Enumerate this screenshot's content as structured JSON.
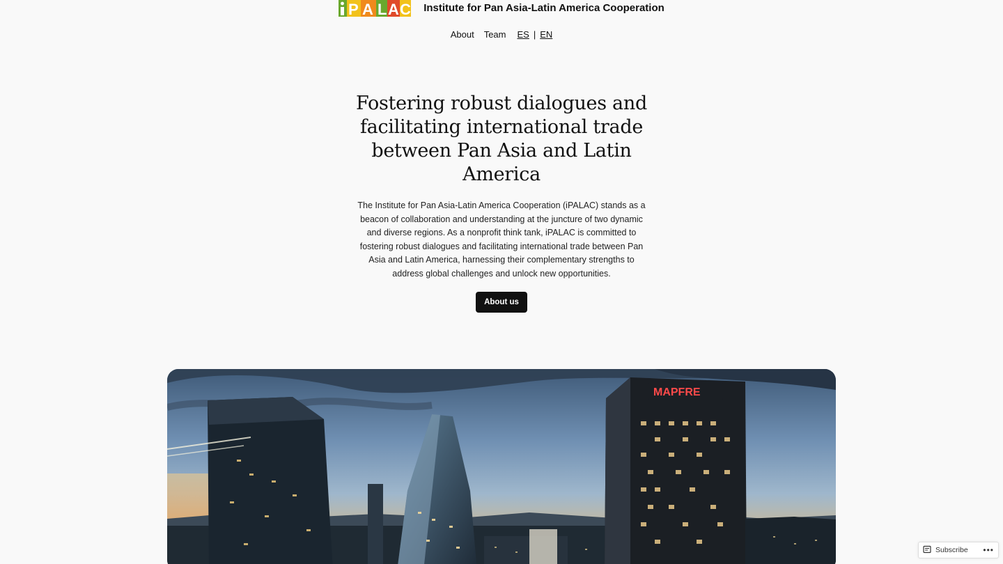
{
  "header": {
    "logo_text": "iPALAC",
    "site_title": "Institute for Pan Asia-Latin America Cooperation",
    "colors": {
      "green": "#6aa82e",
      "orange": "#f08a1c",
      "yellow": "#f2c21a",
      "red": "#e04a2a"
    }
  },
  "nav": {
    "items": [
      {
        "label": "About"
      },
      {
        "label": "Team"
      }
    ],
    "languages": [
      {
        "label": "ES"
      },
      {
        "label": "EN"
      }
    ],
    "separator": "|"
  },
  "hero": {
    "heading": "Fostering robust dialogues and facilitating international trade between Pan Asia and Latin America",
    "body": "The Institute for Pan Asia-Latin America Cooperation (iPALAC) stands as a beacon of collaboration and understanding at the juncture of two dynamic and diverse regions. As a nonprofit think tank, iPALAC is committed to fostering robust dialogues and facilitating international trade between Pan Asia and Latin America, harnessing their complementary strengths to address global challenges and unlock new opportunities.",
    "button_label": "About us"
  },
  "photo": {
    "sign_text": "MAPFRE"
  },
  "subscribe_widget": {
    "label": "Subscribe",
    "more": "•••"
  }
}
